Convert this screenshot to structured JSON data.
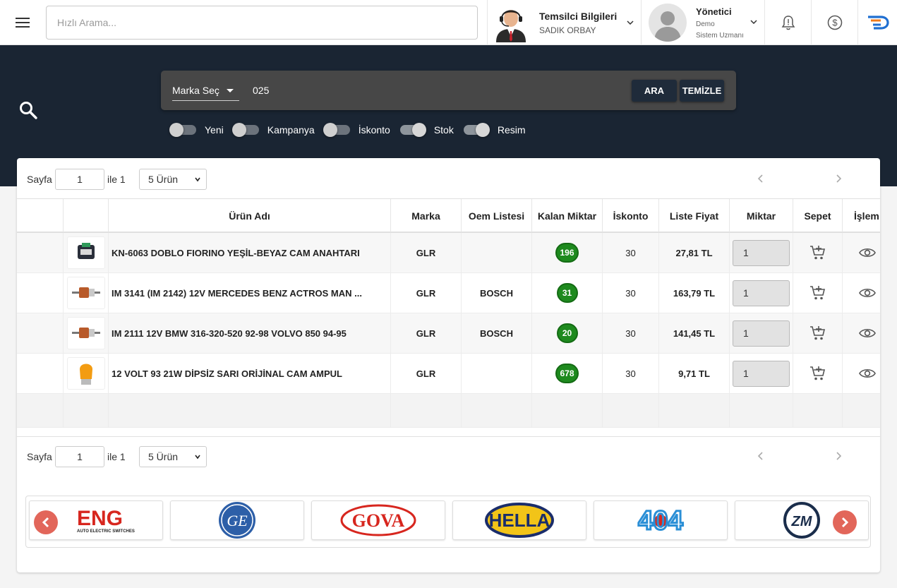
{
  "header": {
    "search_placeholder": "Hızlı Arama...",
    "rep_title": "Temsilci Bilgileri",
    "rep_name": "SADIK ORBAY",
    "admin_title": "Yönetici",
    "admin_line1": "Demo",
    "admin_line2": "Sistem Uzmanı",
    "icons": [
      "menu-icon",
      "bell-icon",
      "dollar-circle-icon",
      "brand-logo-icon"
    ]
  },
  "search": {
    "brand_select_label": "Marka Seç",
    "query": "025",
    "search_button": "ARA",
    "clear_button": "TEMİZLE",
    "filters": [
      {
        "label": "Yeni",
        "on": false
      },
      {
        "label": "Kampanya",
        "on": false
      },
      {
        "label": "İskonto",
        "on": false
      },
      {
        "label": "Stok",
        "on": true
      },
      {
        "label": "Resim",
        "on": true
      }
    ]
  },
  "pager": {
    "page_label": "Sayfa",
    "page_value": "1",
    "of_label": "ile 1",
    "per_page": "5 Ürün"
  },
  "table": {
    "columns": {
      "name": "Ürün Adı",
      "brand": "Marka",
      "oem": "Oem Listesi",
      "stock": "Kalan Miktar",
      "discount": "İskonto",
      "price": "Liste Fiyat",
      "qty": "Miktar",
      "cart": "Sepet",
      "action": "İşlem"
    },
    "rows": [
      {
        "name": "KN-6063 DOBLO FIORINO YEŞİL-BEYAZ CAM ANAHTARI",
        "brand": "GLR",
        "oem": "",
        "stock": "196",
        "discount": "30",
        "price": "27,81 TL",
        "qty": "1"
      },
      {
        "name": "IM 3141 (IM 2142) 12V MERCEDES BENZ ACTROS MAN ...",
        "brand": "GLR",
        "oem": "BOSCH",
        "stock": "31",
        "discount": "30",
        "price": "163,79 TL",
        "qty": "1"
      },
      {
        "name": "IM 2111 12V BMW 316-320-520 92-98 VOLVO 850 94-95",
        "brand": "GLR",
        "oem": "BOSCH",
        "stock": "20",
        "discount": "30",
        "price": "141,45 TL",
        "qty": "1"
      },
      {
        "name": "12 VOLT 93 21W DİPSİZ SARI ORİJİNAL CAM AMPUL",
        "brand": "GLR",
        "oem": "",
        "stock": "678",
        "discount": "30",
        "price": "9,71 TL",
        "qty": "1"
      }
    ]
  },
  "brands": [
    {
      "name": "ENG",
      "subtitle": "AUTO ELECTRIC SWITCHES"
    },
    {
      "name": "GE"
    },
    {
      "name": "GOVA"
    },
    {
      "name": "HELLA"
    },
    {
      "name": "404"
    },
    {
      "name": "ZM"
    }
  ],
  "colors": {
    "hero_bg": "#1a2533",
    "stock_badge": "#1e8a1e",
    "nav_arrow": "#e05a4d"
  }
}
